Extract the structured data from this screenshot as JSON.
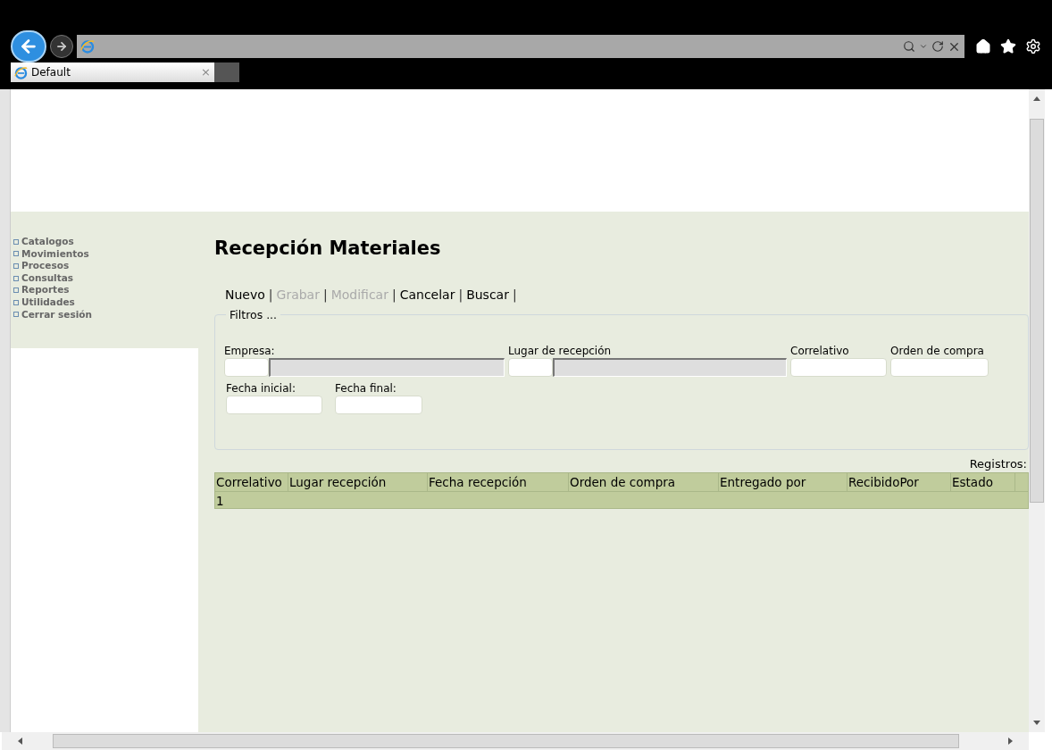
{
  "browser": {
    "tab": {
      "title": "Default",
      "close": "×"
    }
  },
  "sidebar": {
    "items": [
      {
        "label": "Catalogos"
      },
      {
        "label": "Movimientos"
      },
      {
        "label": "Procesos"
      },
      {
        "label": "Consultas"
      },
      {
        "label": "Reportes"
      },
      {
        "label": "Utilidades"
      },
      {
        "label": "Cerrar sesión"
      }
    ]
  },
  "page": {
    "title": "Recepción Materiales"
  },
  "toolbar": {
    "separator": "|",
    "actions": [
      {
        "label": "Nuevo",
        "disabled": false
      },
      {
        "label": "Grabar",
        "disabled": true
      },
      {
        "label": "Modificar",
        "disabled": true
      },
      {
        "label": "Cancelar",
        "disabled": false
      },
      {
        "label": "Buscar",
        "disabled": false
      }
    ]
  },
  "filters": {
    "legend": "Filtros ...",
    "row1": [
      {
        "label": "Empresa:",
        "kind": "lookup"
      },
      {
        "label": "Lugar de recepción",
        "kind": "lookup"
      },
      {
        "label": "Correlativo",
        "kind": "text"
      },
      {
        "label": "Orden de compra",
        "kind": "text"
      }
    ],
    "row2": [
      {
        "label": "Fecha inicial:",
        "kind": "text"
      },
      {
        "label": "Fecha final:",
        "kind": "text"
      }
    ]
  },
  "records_label": "Registros:",
  "table": {
    "columns": [
      "Correlativo",
      "Lugar recepción",
      "Fecha recepción",
      "Orden de compra",
      "Entregado por",
      "RecibidoPor",
      "Estado"
    ],
    "rows": [
      {
        "cells": [
          "1"
        ]
      }
    ]
  }
}
